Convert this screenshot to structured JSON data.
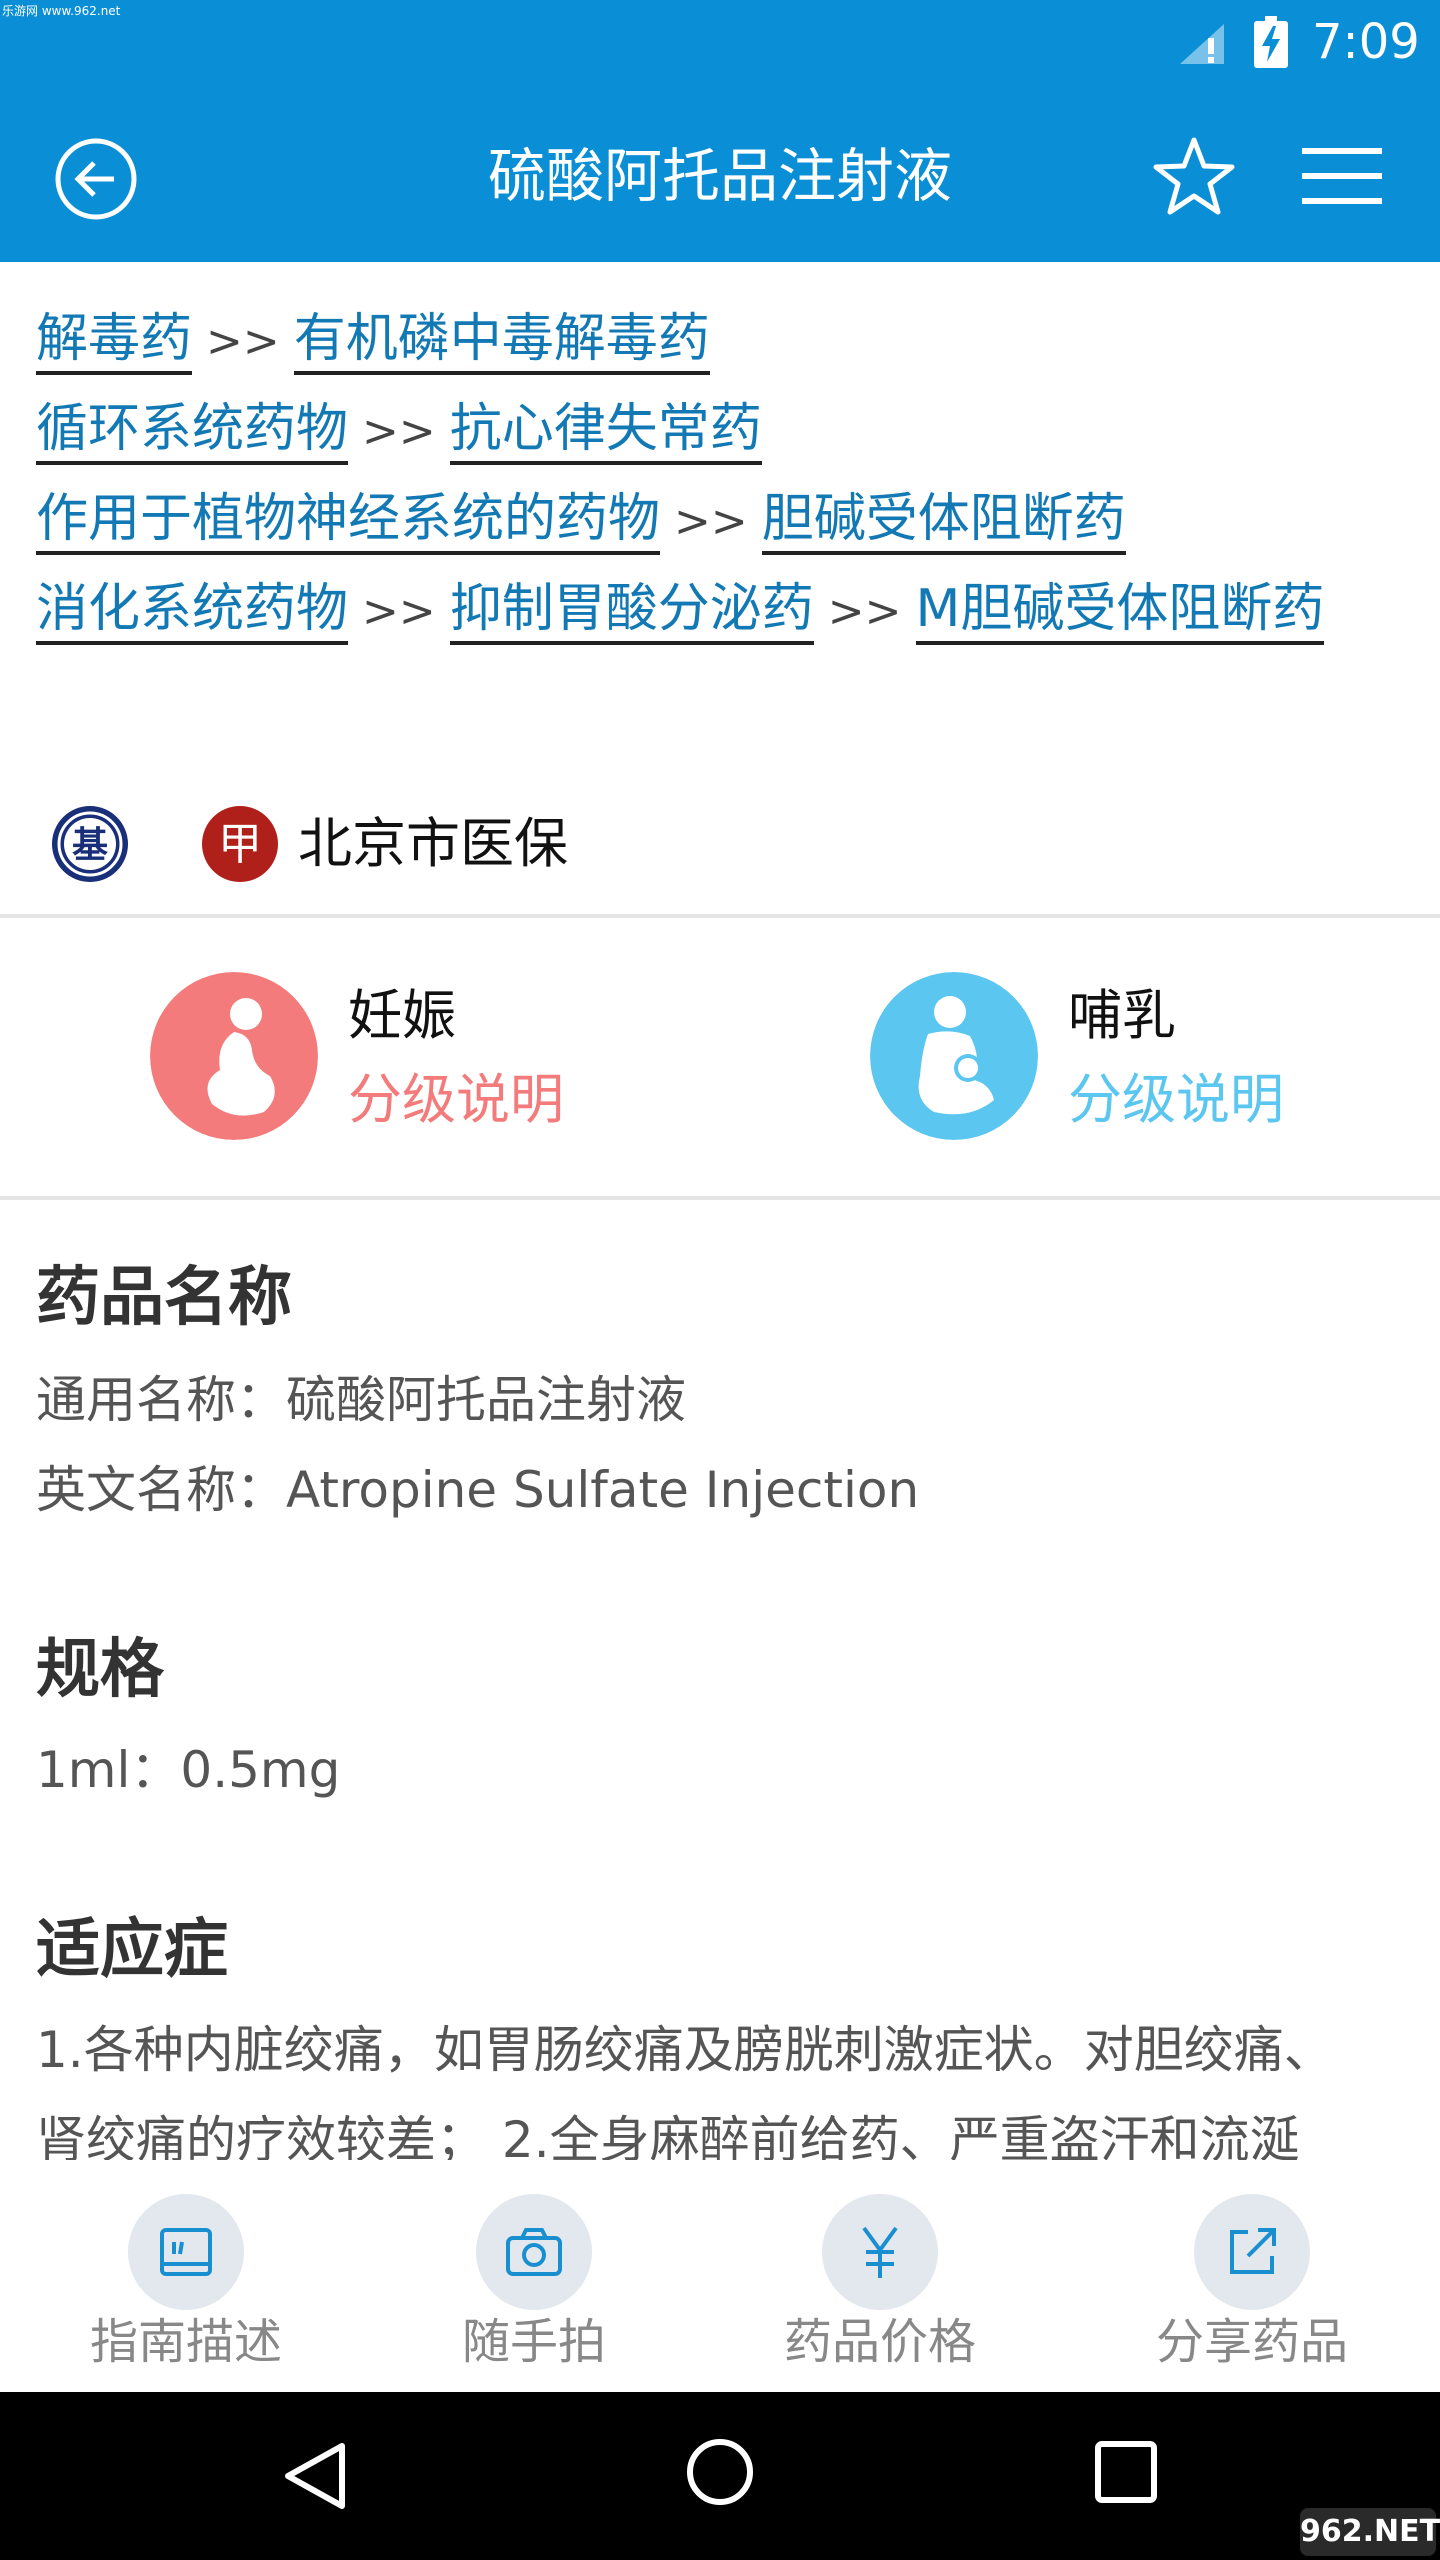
{
  "status_bar": {
    "watermark": "乐游网 www.962.net",
    "time": "7:09"
  },
  "app_bar": {
    "title": "硫酸阿托品注射液",
    "icons": [
      "back-icon",
      "star-icon",
      "menu-icon"
    ]
  },
  "breadcrumbs": [
    [
      "解毒药",
      "有机磷中毒解毒药"
    ],
    [
      "循环系统药物",
      "抗心律失常药"
    ],
    [
      "作用于植物神经系统的药物",
      "胆碱受体阻断药"
    ],
    [
      "消化系统药物",
      "抑制胃酸分泌药",
      "M胆碱受体阻断药"
    ]
  ],
  "breadcrumb_separator": ">>",
  "insurance": {
    "badge_ji": "基",
    "badge_jia": "甲",
    "label": "北京市医保"
  },
  "pregnancy": {
    "title": "妊娠",
    "link": "分级说明",
    "color": "#f47b7b"
  },
  "lactation": {
    "title": "哺乳",
    "link": "分级说明",
    "color": "#5bc6f0"
  },
  "sections": {
    "name": {
      "title": "药品名称",
      "generic": "通用名称：硫酸阿托品注射液",
      "english": "英文名称：Atropine Sulfate Injection"
    },
    "spec": {
      "title": "规格",
      "value": "1ml：0.5mg"
    },
    "indications": {
      "title": "适应症",
      "line1": "1.各种内脏绞痛，如胃肠绞痛及膀胱刺激症状。对胆绞痛、",
      "line2": "肾绞痛的疗效较差； 2.全身麻醉前给药、严重盗汗和流涎"
    }
  },
  "actions": [
    {
      "label": "指南描述",
      "icon": "guide-icon"
    },
    {
      "label": "随手拍",
      "icon": "camera-icon"
    },
    {
      "label": "药品价格",
      "icon": "yuan-icon"
    },
    {
      "label": "分享药品",
      "icon": "share-icon"
    }
  ],
  "watermark_br": "962.NET",
  "colors": {
    "primary": "#0a8fd6",
    "link": "#1379b5"
  }
}
